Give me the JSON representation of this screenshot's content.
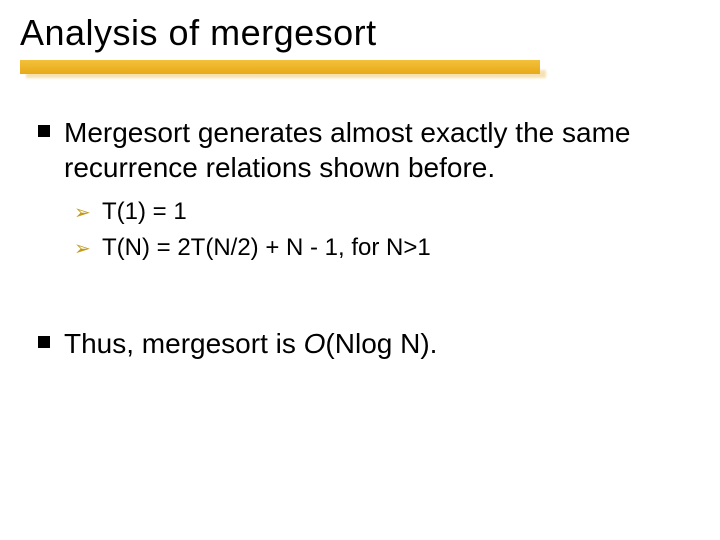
{
  "title": "Analysis of mergesort",
  "b1": {
    "text": "Mergesort generates almost exactly the same recurrence relations shown before.",
    "sub": [
      "T(1) = 1",
      "T(N) = 2T(N/2) + N - 1,  for N>1"
    ]
  },
  "b2": {
    "prefix": "Thus, mergesort is ",
    "ital": "O",
    "suffix": "(Nlog N)."
  }
}
